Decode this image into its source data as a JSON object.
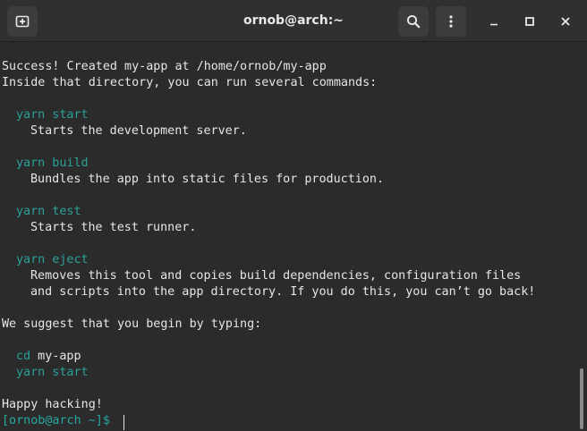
{
  "window": {
    "title": "ornob@arch:~"
  },
  "icons": {
    "new_tab": "new-tab-icon",
    "search": "search-icon",
    "menu": "kebab-menu-icon",
    "minimize": "minimize-icon",
    "maximize": "maximize-icon",
    "close": "close-icon"
  },
  "colors": {
    "background": "#2b2b2b",
    "titlebar": "#303030",
    "command": "#2aa198",
    "text": "#e6e6e6"
  },
  "terminal": {
    "lines": [
      "Success! Created my-app at /home/ornob/my-app",
      "Inside that directory, you can run several commands:",
      "yarn start",
      "Starts the development server.",
      "yarn build",
      "Bundles the app into static files for production.",
      "yarn test",
      "Starts the test runner.",
      "yarn eject",
      "Removes this tool and copies build dependencies, configuration files",
      "and scripts into the app directory. If you do this, you can’t go back!",
      "We suggest that you begin by typing:",
      "cd",
      " my-app",
      "yarn start",
      "Happy hacking!"
    ],
    "prompt": "[ornob@arch ~]$"
  }
}
